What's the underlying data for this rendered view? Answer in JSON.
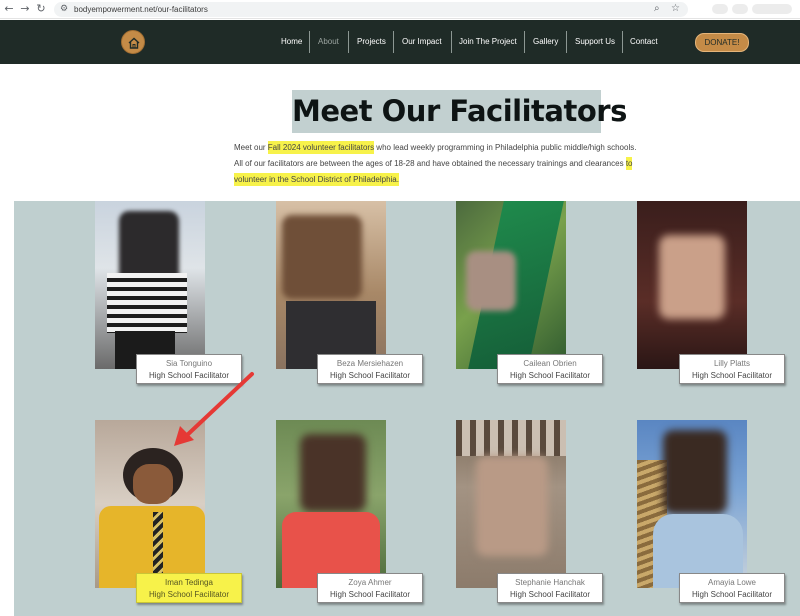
{
  "browser": {
    "url": "bodyempowerment.net/our-facilitators"
  },
  "header": {
    "nav": [
      {
        "label": "Home",
        "active": false
      },
      {
        "label": "About",
        "active": true
      },
      {
        "label": "Projects",
        "active": false
      },
      {
        "label": "Our Impact",
        "active": false
      },
      {
        "label": "Join The Project",
        "active": false
      },
      {
        "label": "Gallery",
        "active": false
      },
      {
        "label": "Support Us",
        "active": false
      },
      {
        "label": "Contact",
        "active": false
      }
    ],
    "donate_label": "DONATE!"
  },
  "page": {
    "title": "Meet Our Facilitators",
    "intro": {
      "part1": "Meet our ",
      "highlight1": "Fall 2024 volunteer facilitators",
      "part2": " who lead weekly programming in Philadelphia public middle/high schools. All of our facilitators are between the ages of 18-28 and have obtained the necessary trainings and clearances ",
      "highlight2": "to volunteer in the School District of Philadelphia."
    }
  },
  "facilitators": [
    {
      "name": "Sia Tonguino",
      "role": "High School Facilitator"
    },
    {
      "name": "Beza Mersiehazen",
      "role": "High School Facilitator"
    },
    {
      "name": "Cailean Obrien",
      "role": "High School Facilitator"
    },
    {
      "name": "Lilly Platts",
      "role": "High School Facilitator"
    },
    {
      "name": "Iman Tedinga",
      "role": "High School Facilitator",
      "highlighted": true
    },
    {
      "name": "Zoya Ahmer",
      "role": "High School Facilitator"
    },
    {
      "name": "Stephanie Hanchak",
      "role": "High School Facilitator"
    },
    {
      "name": "Amayia Lowe",
      "role": "High School Facilitator"
    }
  ],
  "colors": {
    "header_bg": "#1f2b27",
    "accent": "#c48b47",
    "section_bg": "#bfcfcf",
    "highlight": "#f7f24a",
    "arrow": "#e53935"
  }
}
